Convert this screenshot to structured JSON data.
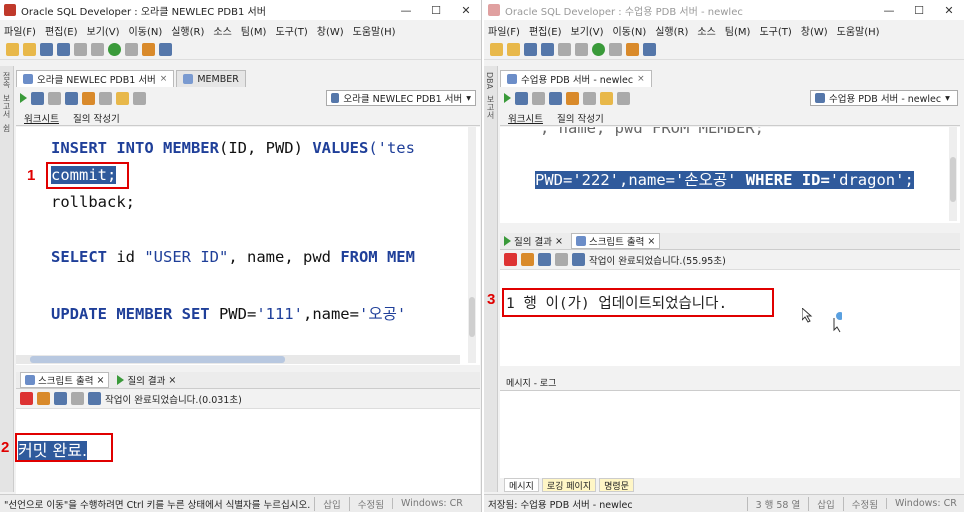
{
  "left": {
    "title": "Oracle SQL Developer : 오라클 NEWLEC PDB1 서버",
    "menu": [
      "파일(F)",
      "편집(E)",
      "보기(V)",
      "이동(N)",
      "실행(R)",
      "소스",
      "팀(M)",
      "도구(T)",
      "창(W)",
      "도움말(H)"
    ],
    "doc_tabs": [
      "오라클 NEWLEC PDB1 서버",
      "MEMBER"
    ],
    "connection": "오라클 NEWLEC PDB1 서버",
    "sub_tabs": [
      "워크시트",
      "질의 작성기"
    ],
    "side_labels": [
      "접속",
      "보고서",
      "쉼"
    ],
    "code": {
      "line1_kw1": "INSERT INTO MEMBER",
      "line1_rest": "(ID, PWD) ",
      "line1_kw2": "VALUES",
      "line1_str": "('tes",
      "line2": "commit;",
      "line3": "rollback;",
      "line4_kw1": "SELECT",
      "line4_a": " id ",
      "line4_str": "\"USER ID\"",
      "line4_b": ", name, pwd ",
      "line4_kw2": "FROM MEM",
      "line5_kw1": "UPDATE MEMBER SET",
      "line5_a": " PWD=",
      "line5_str1": "'111'",
      "line5_b": ",name=",
      "line5_str2": "'오공'"
    },
    "output_tabs": [
      "스크립트 출력",
      "질의 결과"
    ],
    "task_status": "작업이 완료되었습니다.(0.031초)",
    "output_text": "커밋 완료.",
    "status_bar": [
      "\"선언으로 이동\"을 수행하려면 Ctrl 키를 누른 상태에서 식별자를 누르십시오.",
      "삽입",
      "수정됨",
      "Windows: CR"
    ],
    "label_1": "1",
    "label_2": "2"
  },
  "right": {
    "title": "Oracle SQL Developer : 수업용 PDB 서버 - newlec",
    "menu": [
      "파일(F)",
      "편집(E)",
      "보기(V)",
      "이동(N)",
      "실행(R)",
      "소스",
      "팀(M)",
      "도구(T)",
      "창(W)",
      "도움말(H)"
    ],
    "doc_tabs": [
      "수업용 PDB 서버 - newlec"
    ],
    "connection": "수업용 PDB 서버 - newlec",
    "sub_tabs": [
      "워크시트",
      "질의 작성기"
    ],
    "side_labels": [
      "DBA",
      "보고서"
    ],
    "code": {
      "line0": ", name, pwd FROM MEMBER;",
      "line1_a": "PWD=",
      "line1_s1": "'222'",
      "line1_b": ",name=",
      "line1_s2": "'손오공'",
      "line1_kw": " WHERE ID=",
      "line1_s3": "'dragon'",
      "line1_end": ";"
    },
    "output_tabs": [
      "질의 결과",
      "스크립트 출력"
    ],
    "task_status": "작업이 완료되었습니다.(55.95초)",
    "output_text": "1 행 이(가) 업데이트되었습니다.",
    "message_panel": "메시지 - 로그",
    "log_tabs": [
      "메시지",
      "로깅 페이지",
      "명령문"
    ],
    "status_bar": [
      "저장됨: 수업용 PDB 서버 - newlec",
      "3 행 58 열",
      "삽입",
      "수정됨",
      "Windows: CR"
    ],
    "label_3": "3"
  }
}
